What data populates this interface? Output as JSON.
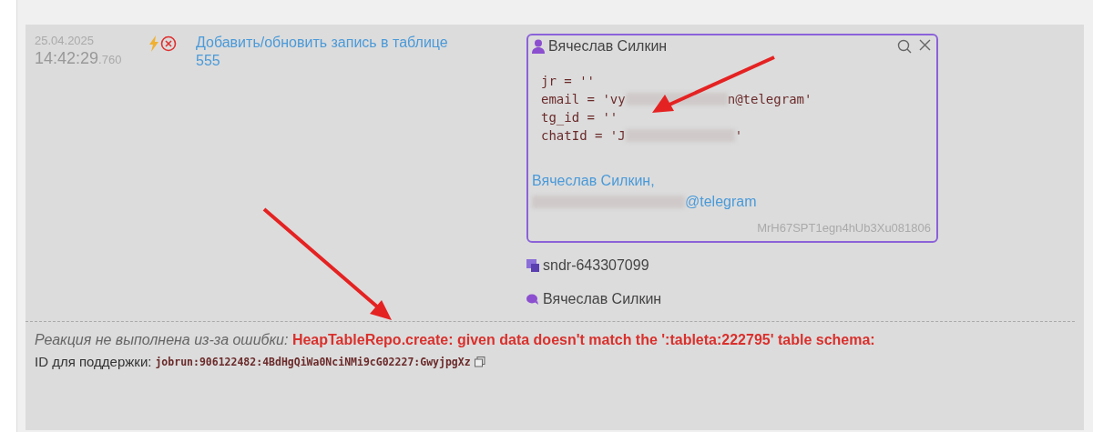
{
  "event": {
    "date": "25.04.2025",
    "time": "14:42:29",
    "ms": ".760",
    "title": "Добавить/обновить запись в таблице",
    "value": "555",
    "card": {
      "name": "Вячеслав Силкин",
      "fields": [
        {
          "parts": [
            "jr = ''"
          ]
        },
        {
          "parts": [
            "email = 'vy",
            "n@telegram'"
          ]
        },
        {
          "parts": [
            "tg_id = ''"
          ]
        },
        {
          "parts": [
            "chatId = 'J",
            "'"
          ]
        }
      ],
      "link_name": "Вячеслав Силкин,",
      "link_email": "@telegram",
      "id": "MrH67SPT1egn4hUb3Xu081806"
    },
    "sender": "sndr-643307099",
    "chat": "Вячеслав Силкин",
    "error_label": "Реакция не выполнена из-за ошибки:",
    "error_text": "HeapTableRepo.create: given data doesn't match the ':tableta:222795' table schema:",
    "support_label": "ID для поддержки:",
    "support_id": "jobrun:906122482:4BdHgQiWa0NciNMi9cG02227:GwyjpgXz"
  }
}
